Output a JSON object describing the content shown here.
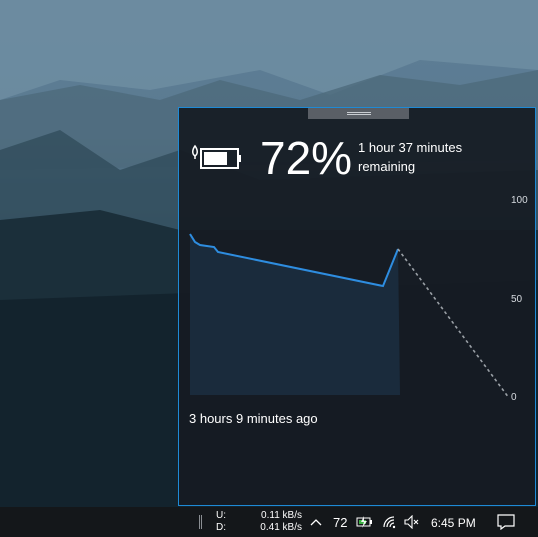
{
  "battery": {
    "percent": "72%",
    "remaining_line1": "1 hour 37 minutes",
    "remaining_line2": "remaining",
    "icon": "battery-charging-icon"
  },
  "graph": {
    "y_ticks": [
      "100",
      "50",
      "0"
    ],
    "history_label": "3 hours 9 minutes ago",
    "history_values": [
      82,
      78,
      77,
      76,
      55,
      75
    ],
    "projection": [
      75,
      0
    ]
  },
  "taskbar": {
    "upload_label": "U:",
    "download_label": "D:",
    "upload_value": "0.11 kB/s",
    "download_value": "0.41 kB/s",
    "battery_number": "72",
    "time": "6:45 PM",
    "icons": [
      "chevron-up-icon",
      "battery-tray-icon",
      "wifi-icon",
      "volume-muted-icon",
      "notification-icon"
    ]
  },
  "colors": {
    "accent": "#1e8ad6",
    "graph_line": "#2e8de0",
    "graph_fill": "#1a2c3e"
  }
}
